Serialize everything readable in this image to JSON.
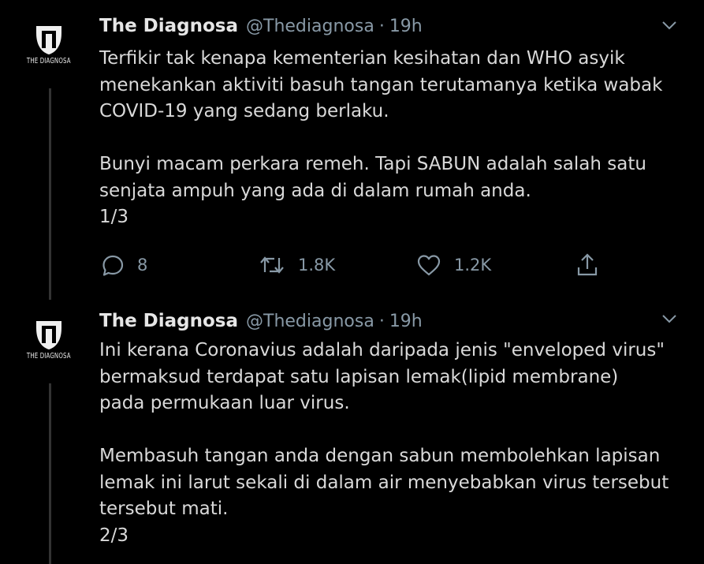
{
  "tweets": [
    {
      "author_name": "The Diagnosa",
      "handle": "@Thediagnosa",
      "separator": "·",
      "time": "19h",
      "avatar_text": "THE DIAGNOSA",
      "text": "Terfikir tak kenapa kementerian kesihatan dan WHO asyik\nmenekankan aktiviti basuh tangan terutamanya ketika wabak\nCOVID-19 yang sedang berlaku.\n\nBunyi macam perkara remeh. Tapi SABUN adalah salah satu\nsenjata ampuh yang ada di dalam rumah anda.\n1/3",
      "replies": "8",
      "retweets": "1.8K",
      "likes": "1.2K"
    },
    {
      "author_name": "The Diagnosa",
      "handle": "@Thediagnosa",
      "separator": "·",
      "time": "19h",
      "avatar_text": "THE DIAGNOSA",
      "text": "Ini kerana Coronavius adalah daripada jenis \"enveloped virus\"\nbermaksud terdapat satu lapisan lemak(lipid membrane)\npada permukaan luar virus.\n\nMembasuh tangan anda dengan sabun membolehkan lapisan\nlemak ini larut sekali di dalam air menyebabkan virus tersebut\ntersebut mati.\n2/3"
    }
  ],
  "icons": {
    "reply": "reply-icon",
    "retweet": "retweet-icon",
    "like": "heart-icon",
    "share": "share-icon",
    "more": "chevron-down-icon"
  },
  "colors": {
    "background": "#000000",
    "text": "#d9d9d9",
    "muted": "#8899a6",
    "thread_line": "#333333"
  }
}
